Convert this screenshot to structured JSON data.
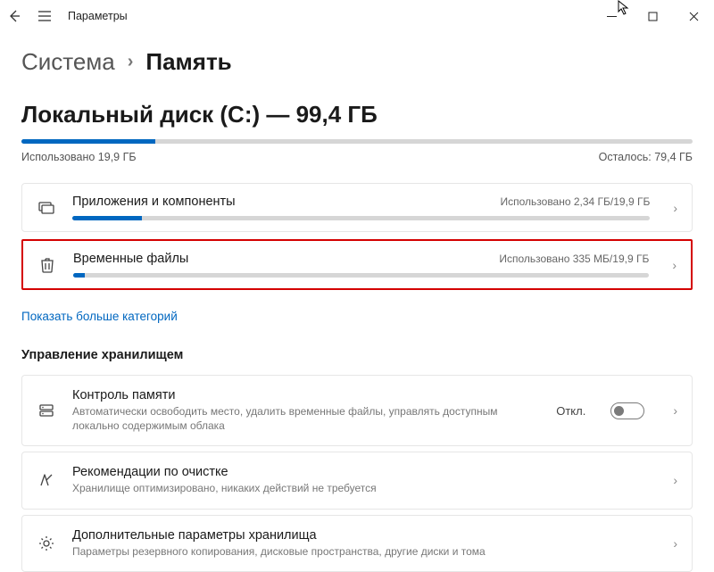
{
  "app_title": "Параметры",
  "breadcrumb": {
    "parent": "Система",
    "current": "Память"
  },
  "disk": {
    "title": "Локальный диск (C:) — 99,4 ГБ",
    "used_percent": 20,
    "used_label": "Использовано 19,9 ГБ",
    "free_label": "Осталось: 79,4 ГБ"
  },
  "categories": [
    {
      "title": "Приложения и компоненты",
      "usage": "Использовано 2,34 ГБ/19,9 ГБ",
      "fill_percent": 12,
      "highlight": false
    },
    {
      "title": "Временные файлы",
      "usage": "Использовано 335 МБ/19,9 ГБ",
      "fill_percent": 2,
      "highlight": true
    }
  ],
  "show_more": "Показать больше категорий",
  "mgmt_heading": "Управление хранилищем",
  "mgmt": [
    {
      "title": "Контроль памяти",
      "desc": "Автоматически освободить место, удалить временные файлы, управлять доступным локально содержимым облака",
      "status": "Откл.",
      "has_toggle": true
    },
    {
      "title": "Рекомендации по очистке",
      "desc": "Хранилище оптимизировано, никаких действий не требуется",
      "has_toggle": false
    },
    {
      "title": "Дополнительные параметры хранилища",
      "desc": "Параметры резервного копирования, дисковые пространства, другие диски и тома",
      "has_toggle": false
    }
  ]
}
